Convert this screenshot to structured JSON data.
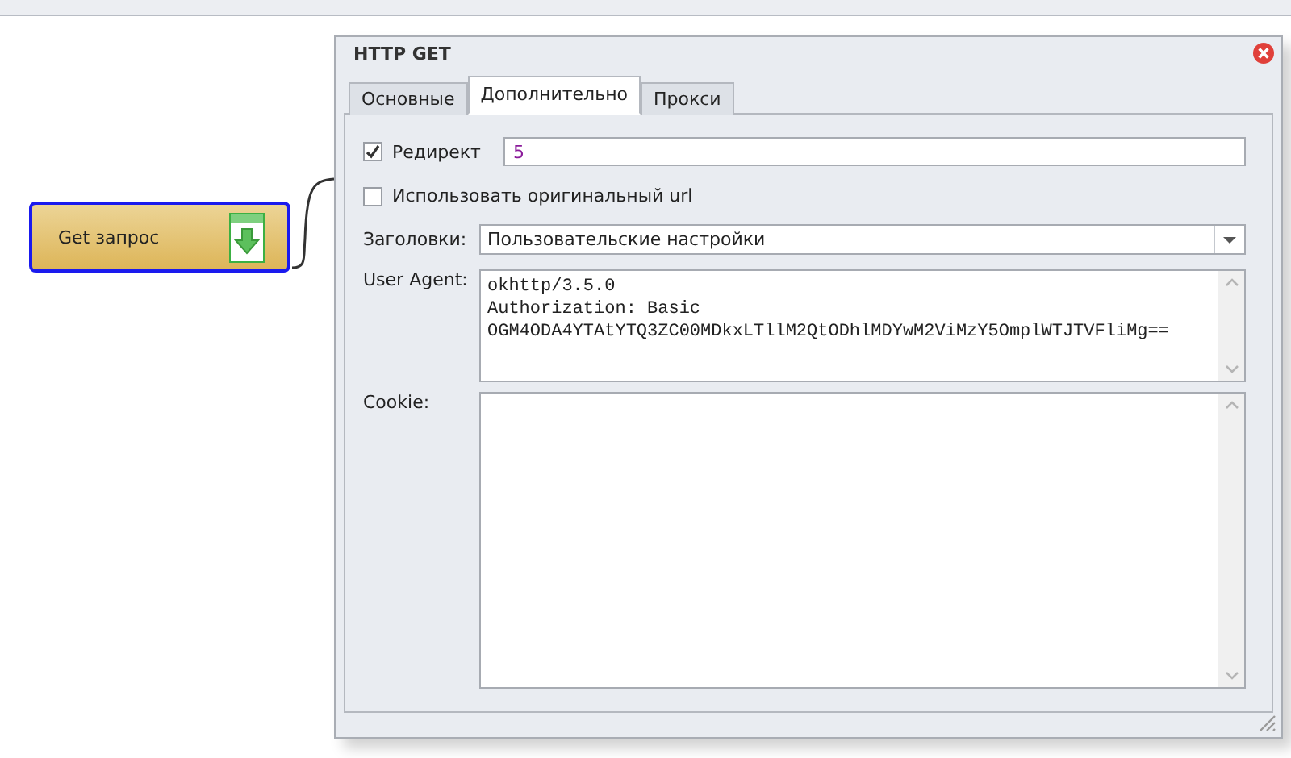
{
  "node": {
    "label": "Get запрос"
  },
  "dialog": {
    "title": "HTTP GET",
    "tabs": [
      {
        "label": "Основные",
        "selected": false
      },
      {
        "label": "Дополнительно",
        "selected": true
      },
      {
        "label": "Прокси",
        "selected": false
      }
    ],
    "redirect": {
      "label": "Редирект",
      "checked": true,
      "value": "5"
    },
    "original_url": {
      "label": "Использовать оригинальный url",
      "checked": false
    },
    "headers": {
      "label": "Заголовки:",
      "value": "Пользовательские настройки"
    },
    "user_agent": {
      "label": "User Agent:",
      "lines": [
        "okhttp/3.5.0",
        "Authorization: Basic",
        "OGM4ODA4YTAtYTQ3ZC00MDkxLTllM2QtODhlMDYwM2ViMzY5OmplWTJTVFliMg=="
      ]
    },
    "cookie": {
      "label": "Cookie:"
    }
  }
}
